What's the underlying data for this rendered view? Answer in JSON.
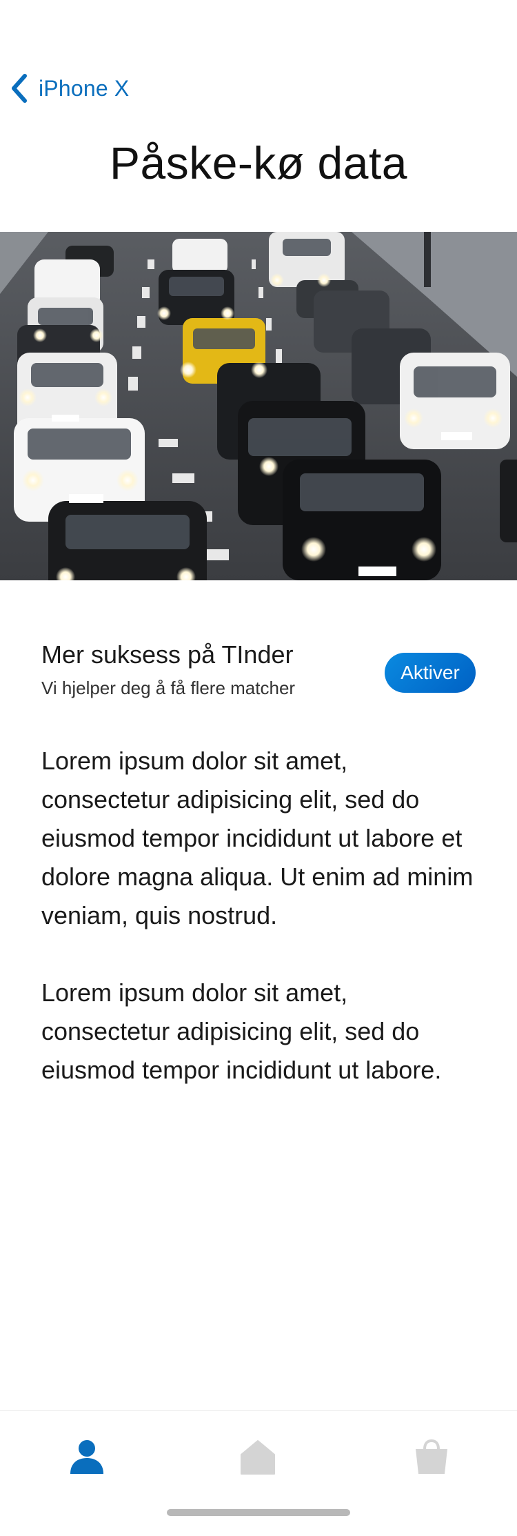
{
  "nav": {
    "back_label": "iPhone X",
    "back_icon": "chevron-left-icon",
    "accent_color": "#0a6ebd"
  },
  "page": {
    "title": "Påske-kø data"
  },
  "hero": {
    "icon": "traffic-photo"
  },
  "promo": {
    "title": "Mer suksess på TInder",
    "subtitle": "Vi hjelper deg å få flere matcher",
    "button_label": "Aktiver",
    "button_color": "#0a7ad3"
  },
  "content": {
    "paragraphs": [
      "Lorem ipsum dolor sit amet, consectetur adipisicing elit, sed do eiusmod tempor incididunt ut labore et dolore magna aliqua. Ut enim ad minim veniam, quis nostrud.",
      "Lorem ipsum dolor sit amet, consectetur adipisicing elit, sed do eiusmod tempor incididunt ut labore."
    ]
  },
  "tabbar": {
    "items": [
      {
        "icon": "person-icon",
        "active": true
      },
      {
        "icon": "home-icon",
        "active": false
      },
      {
        "icon": "shopping-bag-icon",
        "active": false
      }
    ],
    "active_color": "#0a6ebd",
    "inactive_color": "#d4d4d4"
  }
}
